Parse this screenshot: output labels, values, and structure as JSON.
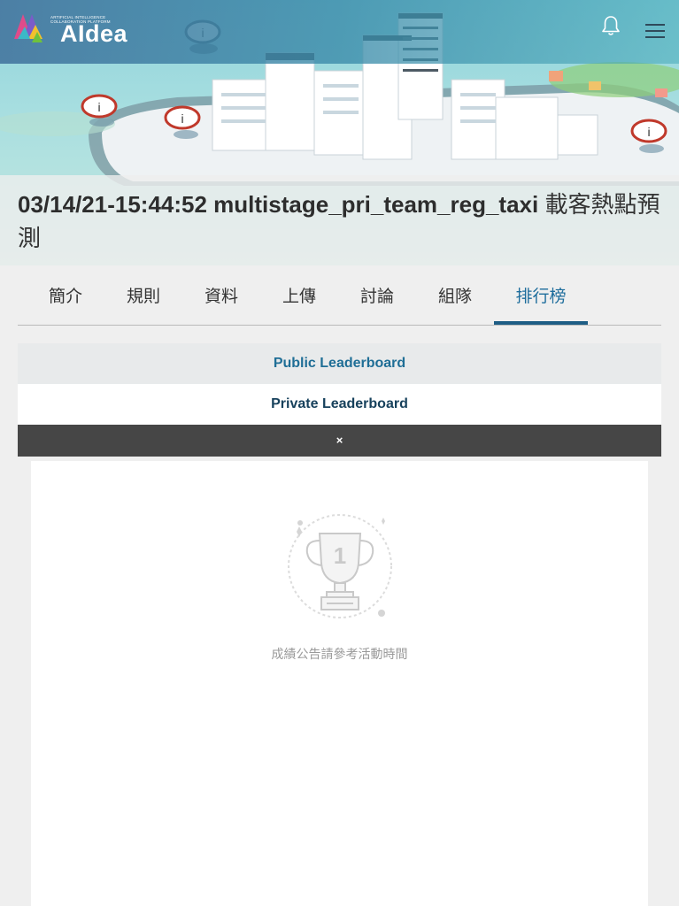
{
  "header": {
    "logo_text": "AIdea",
    "logo_tagline": "ARTIFICIAL INTELLIGENCE COLLABORATION PLATFORM",
    "icons": [
      "bell-icon",
      "hamburger-menu-icon"
    ]
  },
  "competition": {
    "title_en": "03/14/21-15:44:52 multistage_pri_team_reg_taxi",
    "title_zh": "載客熱點預測"
  },
  "tabs": [
    {
      "label": "簡介"
    },
    {
      "label": "規則"
    },
    {
      "label": "資料"
    },
    {
      "label": "上傳"
    },
    {
      "label": "討論"
    },
    {
      "label": "組隊"
    },
    {
      "label": "排行榜",
      "active": true
    }
  ],
  "leaderboard": {
    "public_label": "Public Leaderboard",
    "private_label": "Private Leaderboard",
    "close_symbol": "×",
    "empty_message": "成績公告請參考活動時間"
  },
  "colors": {
    "accent": "#1e5d85",
    "header_overlay": "#4a86a8",
    "alert_bar": "#464646",
    "page_bg": "#efefef"
  }
}
